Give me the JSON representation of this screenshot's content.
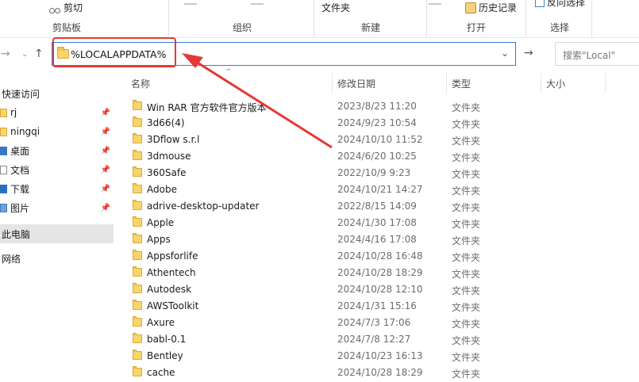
{
  "ribbon": {
    "cut_label": "剪切",
    "clipboard_label": "剪贴板",
    "organize_label": "组织",
    "folder_label": "文件夹",
    "new_label": "新建",
    "history_label": "历史记录",
    "open_label": "打开",
    "invert_label": "反向选择",
    "select_label": "选择"
  },
  "address": {
    "path": "%LOCALAPPDATA%"
  },
  "search": {
    "placeholder": "搜索\"Local\""
  },
  "sidebar": {
    "quick_access": "快速访问",
    "items": [
      {
        "label": "rj",
        "icon": "folder-icon"
      },
      {
        "label": "ningqi",
        "icon": "folder-icon"
      },
      {
        "label": "桌面",
        "icon": "desktop-icon"
      },
      {
        "label": "文档",
        "icon": "document-icon"
      },
      {
        "label": "下载",
        "icon": "download-icon"
      },
      {
        "label": "图片",
        "icon": "pictures-icon"
      }
    ],
    "this_pc": "此电脑",
    "network": "网络"
  },
  "columns": {
    "name": "名称",
    "date": "修改日期",
    "type": "类型",
    "size": "大小"
  },
  "files": [
    {
      "name": " Win RAR 官方软件官方版本",
      "date": "2023/8/23 11:20",
      "type": "文件夹"
    },
    {
      "name": "3d66(4)",
      "date": "2024/9/23 10:54",
      "type": "文件夹"
    },
    {
      "name": "3Dflow s.r.l",
      "date": "2024/10/10 11:52",
      "type": "文件夹"
    },
    {
      "name": "3dmouse",
      "date": "2024/6/20 10:25",
      "type": "文件夹"
    },
    {
      "name": "360Safe",
      "date": "2022/10/9 9:23",
      "type": "文件夹"
    },
    {
      "name": "Adobe",
      "date": "2024/10/21 14:27",
      "type": "文件夹"
    },
    {
      "name": "adrive-desktop-updater",
      "date": "2022/8/15 14:09",
      "type": "文件夹"
    },
    {
      "name": "Apple",
      "date": "2024/1/30 17:08",
      "type": "文件夹"
    },
    {
      "name": "Apps",
      "date": "2024/4/16 17:08",
      "type": "文件夹"
    },
    {
      "name": "Appsforlife",
      "date": "2024/10/28 16:48",
      "type": "文件夹"
    },
    {
      "name": "Athentech",
      "date": "2024/10/28 18:29",
      "type": "文件夹"
    },
    {
      "name": "Autodesk",
      "date": "2024/10/28 12:10",
      "type": "文件夹"
    },
    {
      "name": "AWSToolkit",
      "date": "2024/1/31 15:16",
      "type": "文件夹"
    },
    {
      "name": "Axure",
      "date": "2024/7/3 17:06",
      "type": "文件夹"
    },
    {
      "name": "babl-0.1",
      "date": "2024/7/8 12:27",
      "type": "文件夹"
    },
    {
      "name": "Bentley",
      "date": "2024/10/23 16:13",
      "type": "文件夹"
    },
    {
      "name": "cache",
      "date": "2024/10/28 18:29",
      "type": "文件夹"
    }
  ],
  "colors": {
    "accent": "#3b7bd4",
    "annotation": "#e53935",
    "folder": "#f8d56b"
  }
}
